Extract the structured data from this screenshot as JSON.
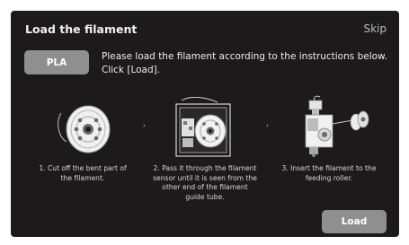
{
  "header": {
    "title": "Load the filament",
    "skip_label": "Skip"
  },
  "filament": {
    "type_label": "PLA"
  },
  "instructions": {
    "line1": "Please load the filament according to the instructions below.",
    "line2": "Click [Load]."
  },
  "steps": [
    {
      "icon": "filament-spool-icon",
      "caption_lines": [
        "1. Cut off the bent part  of",
        "the filament."
      ]
    },
    {
      "icon": "printer-filament-sensor-icon",
      "caption_lines": [
        "2. Pass it through the filament",
        "sensor until it is seen from the",
        "other end of the filament",
        "guide tube."
      ]
    },
    {
      "icon": "extruder-feeding-roller-icon",
      "caption_lines": [
        "3. Insert the filament to the",
        "feeding roller."
      ]
    }
  ],
  "arrow_glyph": "›",
  "load_label": "Load"
}
